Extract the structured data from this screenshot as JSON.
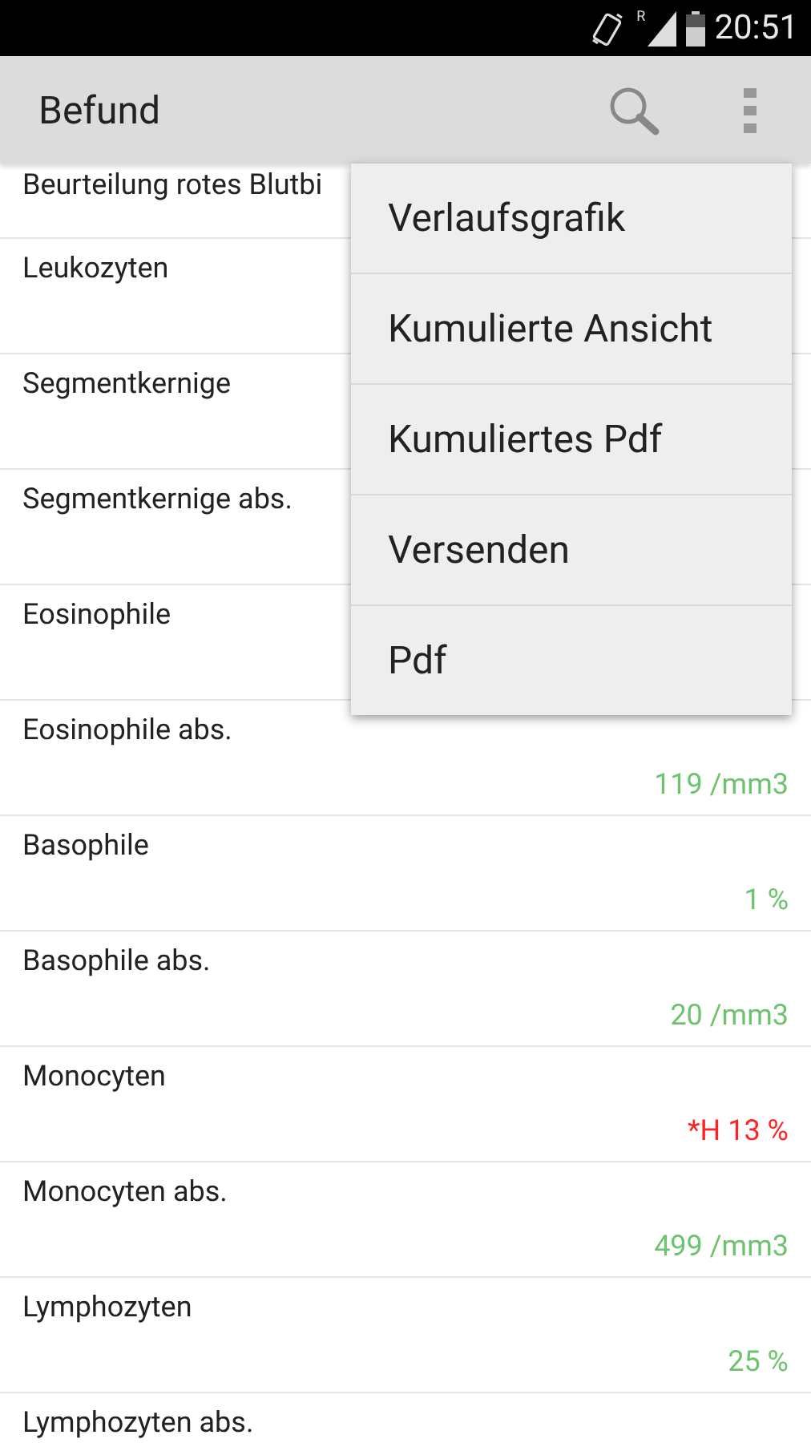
{
  "status_bar": {
    "roaming": "R",
    "time": "20:51"
  },
  "app_bar": {
    "title": "Befund"
  },
  "results": [
    {
      "name": "Beurteilung rotes Blutbi"
    },
    {
      "name": "Leukozyten"
    },
    {
      "name": "Segmentkernige"
    },
    {
      "name": "Segmentkernige abs."
    },
    {
      "name": "Eosinophile"
    },
    {
      "name": "Eosinophile abs.",
      "value": "119 /mm3",
      "color": "#6cc36c"
    },
    {
      "name": "Basophile",
      "value": "1 %",
      "color": "#6cc36c"
    },
    {
      "name": "Basophile abs.",
      "value": "20 /mm3",
      "color": "#6cc36c"
    },
    {
      "name": "Monocyten",
      "value": "*H 13 %",
      "color": "#ff2222"
    },
    {
      "name": "Monocyten abs.",
      "value": "499 /mm3",
      "color": "#6cc36c"
    },
    {
      "name": "Lymphozyten",
      "value": "25 %",
      "color": "#6cc36c"
    },
    {
      "name": "Lymphozyten abs."
    }
  ],
  "menu": [
    "Verlaufsgrafik",
    "Kumulierte Ansicht",
    "Kumuliertes Pdf",
    "Versenden",
    "Pdf"
  ]
}
